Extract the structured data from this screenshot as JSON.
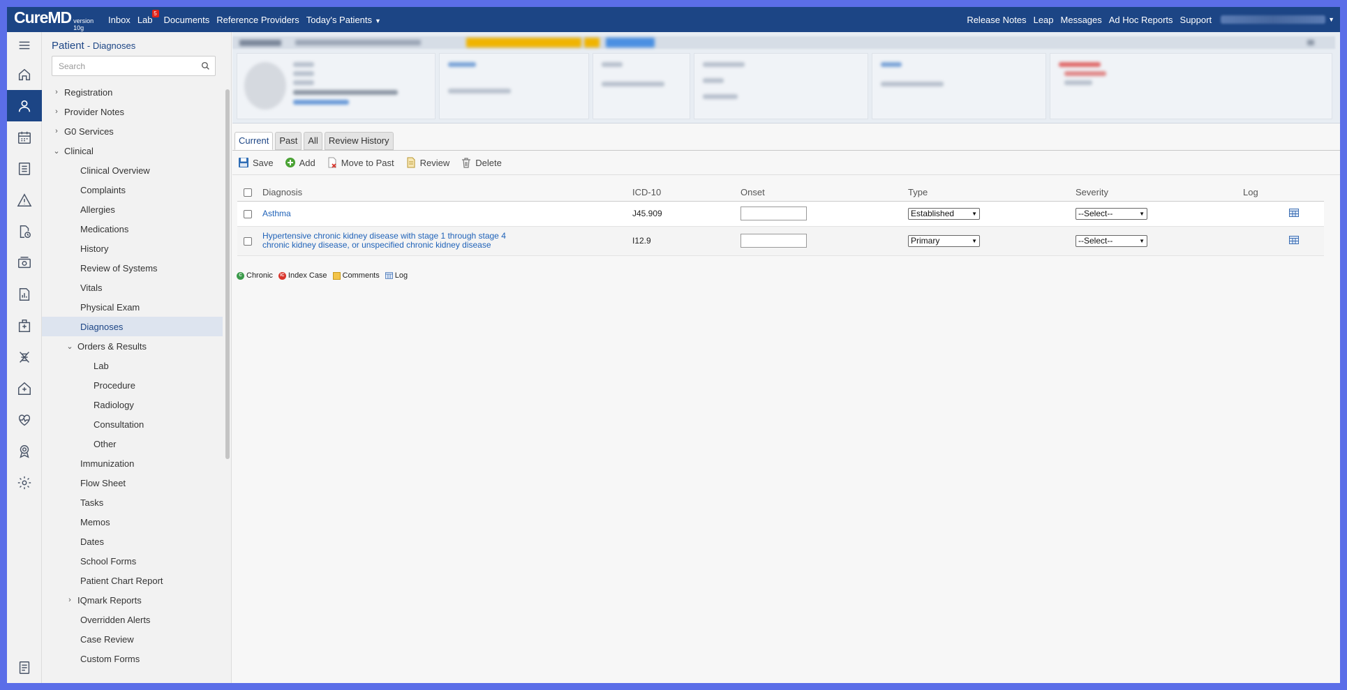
{
  "topbar": {
    "brand": "CureMD",
    "version": "version 10g",
    "nav": [
      {
        "label": "Inbox"
      },
      {
        "label": "Lab",
        "badge": "5"
      },
      {
        "label": "Documents"
      },
      {
        "label": "Reference Providers"
      },
      {
        "label": "Today's Patients"
      }
    ],
    "right_nav": [
      "Release Notes",
      "Leap",
      "Messages",
      "Ad Hoc Reports",
      "Support"
    ]
  },
  "rail": [
    "menu-icon",
    "home-icon",
    "patient-icon",
    "calendar-icon",
    "list-icon",
    "alert-icon",
    "document-clock-icon",
    "billing-icon",
    "chart-report-icon",
    "hospital-icon",
    "dna-icon",
    "house-medical-icon",
    "heart-pulse-icon",
    "award-icon",
    "gear-icon",
    "notes-icon"
  ],
  "sidebar": {
    "title": "Patient",
    "subtitle": "- Diagnoses",
    "search_placeholder": "Search",
    "items": [
      {
        "label": "Registration",
        "level": "l0",
        "chev": "›"
      },
      {
        "label": "Provider Notes",
        "level": "l0",
        "chev": "›"
      },
      {
        "label": "G0 Services",
        "level": "l0",
        "chev": "›"
      },
      {
        "label": "Clinical",
        "level": "l0",
        "chev": "⌄"
      },
      {
        "label": "Clinical Overview",
        "level": "l1"
      },
      {
        "label": "Complaints",
        "level": "l1"
      },
      {
        "label": "Allergies",
        "level": "l1"
      },
      {
        "label": "Medications",
        "level": "l1"
      },
      {
        "label": "History",
        "level": "l1"
      },
      {
        "label": "Review of Systems",
        "level": "l1"
      },
      {
        "label": "Vitals",
        "level": "l1"
      },
      {
        "label": "Physical Exam",
        "level": "l1"
      },
      {
        "label": "Diagnoses",
        "level": "l1",
        "active": true
      },
      {
        "label": "Orders & Results",
        "level": "l1c",
        "chev": "⌄"
      },
      {
        "label": "Lab",
        "level": "l2"
      },
      {
        "label": "Procedure",
        "level": "l2"
      },
      {
        "label": "Radiology",
        "level": "l2"
      },
      {
        "label": "Consultation",
        "level": "l2"
      },
      {
        "label": "Other",
        "level": "l2"
      },
      {
        "label": "Immunization",
        "level": "l1"
      },
      {
        "label": "Flow Sheet",
        "level": "l1"
      },
      {
        "label": "Tasks",
        "level": "l1"
      },
      {
        "label": "Memos",
        "level": "l1"
      },
      {
        "label": "Dates",
        "level": "l1"
      },
      {
        "label": "School Forms",
        "level": "l1"
      },
      {
        "label": "Patient Chart Report",
        "level": "l1"
      },
      {
        "label": "IQmark Reports",
        "level": "l1c",
        "chev": "›"
      },
      {
        "label": "Overridden Alerts",
        "level": "l1"
      },
      {
        "label": "Case Review",
        "level": "l1"
      },
      {
        "label": "Custom Forms",
        "level": "l1"
      }
    ]
  },
  "tabs": [
    {
      "label": "Current",
      "active": true
    },
    {
      "label": "Past"
    },
    {
      "label": "All"
    },
    {
      "label": "Review History"
    }
  ],
  "toolbar": {
    "save": "Save",
    "add": "Add",
    "move_to_past": "Move to Past",
    "review": "Review",
    "delete": "Delete"
  },
  "table": {
    "headers": {
      "diagnosis": "Diagnosis",
      "icd": "ICD-10",
      "onset": "Onset",
      "type": "Type",
      "severity": "Severity",
      "log": "Log"
    },
    "rows": [
      {
        "diagnosis": "Asthma",
        "icd": "J45.909",
        "onset": "",
        "type": "Established",
        "severity": "--Select--"
      },
      {
        "diagnosis": "Hypertensive chronic kidney disease with stage 1 through stage 4 chronic kidney disease, or unspecified chronic kidney disease",
        "icd": "I12.9",
        "onset": "",
        "type": "Primary",
        "severity": "--Select--"
      }
    ]
  },
  "legend": {
    "chronic": "Chronic",
    "index_case": "Index Case",
    "comments": "Comments",
    "log": "Log"
  },
  "colors": {
    "topbar": "#1c4585",
    "link": "#1f62b8",
    "frame": "#5b6ee8"
  }
}
